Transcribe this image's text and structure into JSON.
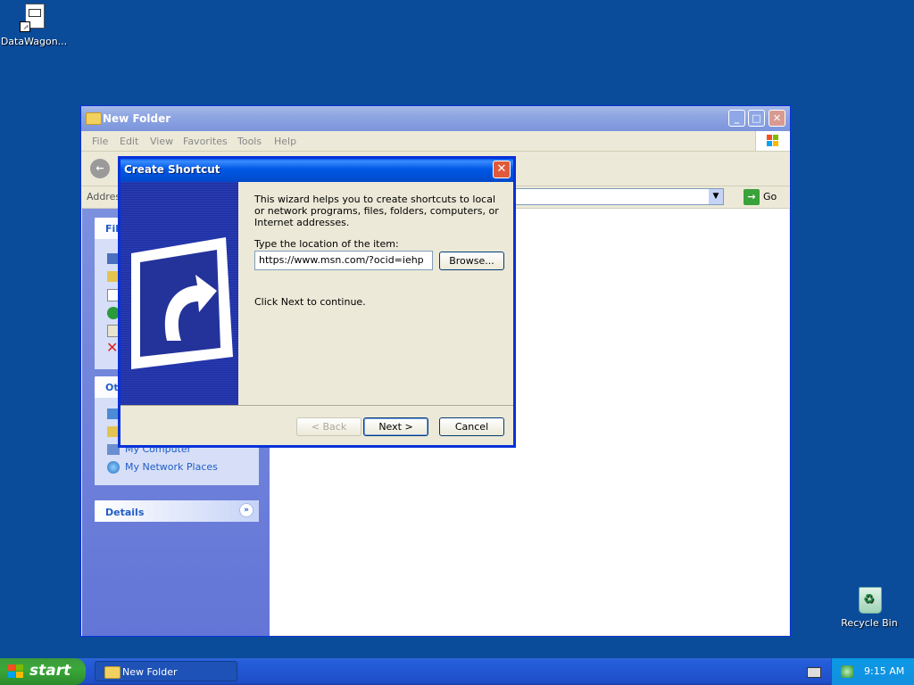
{
  "desktop": {
    "icons": [
      {
        "label": "DataWagon..."
      },
      {
        "label": "Recycle Bin"
      }
    ]
  },
  "explorer": {
    "title": "New Folder",
    "menu": [
      "File",
      "Edit",
      "View",
      "Favorites",
      "Tools",
      "Help"
    ],
    "address_label": "Address",
    "go_label": "Go",
    "task_panels": [
      {
        "title": "File and Folder Tasks",
        "visible_title": "Fil"
      },
      {
        "title": "Other Places",
        "visible_title": "Oth"
      },
      {
        "title": "Details"
      }
    ],
    "other_places": [
      "My Computer",
      "My Network Places"
    ]
  },
  "dialog": {
    "title": "Create Shortcut",
    "intro": "This wizard helps you to create shortcuts to local or network programs, files, folders, computers, or Internet addresses.",
    "location_label": "Type the location of the item:",
    "location_value": "https://www.msn.com/?ocid=iehp",
    "browse_label": "Browse...",
    "continue_text": "Click Next to continue.",
    "back_label": "< Back",
    "next_label": "Next >",
    "cancel_label": "Cancel"
  },
  "taskbar": {
    "start_label": "start",
    "task_item": "New Folder",
    "clock": "9:15 AM"
  }
}
